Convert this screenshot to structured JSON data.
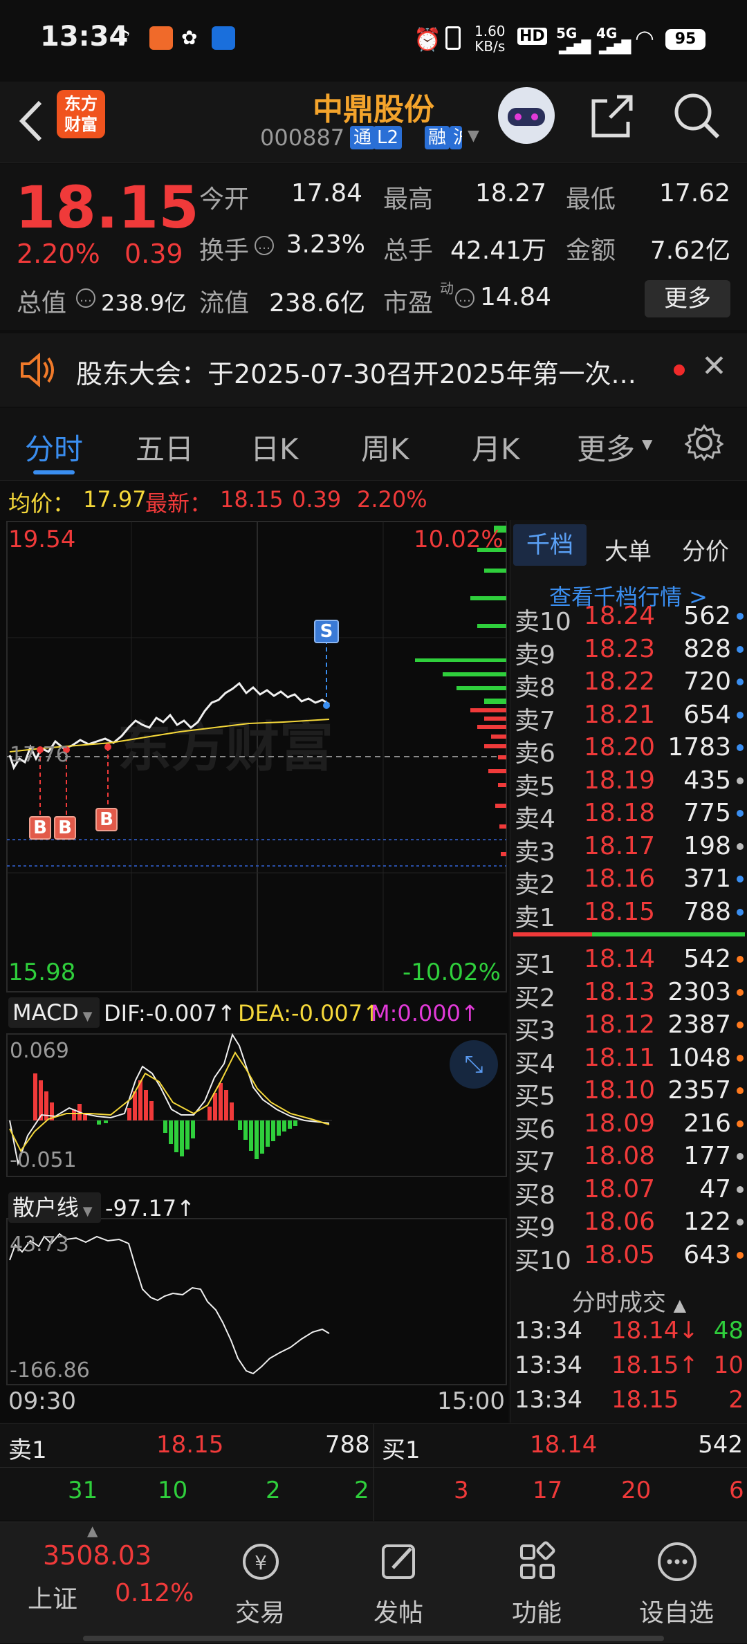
{
  "status_bar": {
    "time": "13:34",
    "net_speed_top": "1.60",
    "net_speed_unit": "KB/s",
    "signal_1": "5G",
    "signal_2": "4G",
    "battery": "95"
  },
  "header": {
    "logo_text_1": "东方",
    "logo_text_2": "财富",
    "stock_name": "中鼎股份",
    "stock_code": "000887",
    "tags": [
      "通",
      "L2",
      "融",
      "沪"
    ]
  },
  "quote": {
    "price": "18.15",
    "change_pct": "2.20%",
    "change": "0.39",
    "open_label": "今开",
    "open": "17.84",
    "high_label": "最高",
    "high": "18.27",
    "low_label": "最低",
    "low": "17.62",
    "turnover_label": "换手",
    "turnover": "3.23%",
    "volume_label": "总手",
    "volume": "42.41万",
    "amount_label": "金额",
    "amount": "7.62亿",
    "mktcap_label": "总值",
    "mktcap": "238.9亿",
    "float_label": "流值",
    "float": "238.6亿",
    "pe_label": "市盈",
    "pe_sup": "动",
    "pe": "14.84",
    "more_label": "更多"
  },
  "notice": {
    "text": "股东大会：于2025-07-30召开2025年第一次..."
  },
  "tabs": [
    "分时",
    "五日",
    "日K",
    "周K",
    "月K",
    "更多"
  ],
  "avg_bar": {
    "avg_label": "均价：",
    "avg": "17.97",
    "latest_label": "最新：",
    "latest": "18.15",
    "change": "0.39",
    "pct": "2.20%"
  },
  "chart": {
    "y_top": "19.54",
    "y_top_pct": "10.02%",
    "y_bottom": "15.98",
    "y_bottom_pct": "-10.02%",
    "prev_close": "17.76",
    "watermark": "东方财富",
    "time_start": "09:30",
    "time_end": "15:00",
    "markers": [
      "B",
      "B",
      "B",
      "S"
    ]
  },
  "macd": {
    "name": "MACD",
    "dif": "DIF:-0.007↑",
    "dea": "DEA:-0.007↑",
    "m": "M:0.000↑",
    "y_top": "0.069",
    "y_bottom": "-0.051"
  },
  "retail": {
    "name": "散户线",
    "value": "-97.17↑",
    "y_top": "43.73",
    "y_bottom": "-166.86"
  },
  "panel_tabs": [
    "千档",
    "大单",
    "分价"
  ],
  "panel_link": "查看千档行情 >",
  "sell_orders": [
    {
      "label": "卖10",
      "price": "18.24",
      "vol": "562"
    },
    {
      "label": "卖9",
      "price": "18.23",
      "vol": "828"
    },
    {
      "label": "卖8",
      "price": "18.22",
      "vol": "720"
    },
    {
      "label": "卖7",
      "price": "18.21",
      "vol": "654"
    },
    {
      "label": "卖6",
      "price": "18.20",
      "vol": "1783"
    },
    {
      "label": "卖5",
      "price": "18.19",
      "vol": "435"
    },
    {
      "label": "卖4",
      "price": "18.18",
      "vol": "775"
    },
    {
      "label": "卖3",
      "price": "18.17",
      "vol": "198"
    },
    {
      "label": "卖2",
      "price": "18.16",
      "vol": "371"
    },
    {
      "label": "卖1",
      "price": "18.15",
      "vol": "788"
    }
  ],
  "buy_orders": [
    {
      "label": "买1",
      "price": "18.14",
      "vol": "542"
    },
    {
      "label": "买2",
      "price": "18.13",
      "vol": "2303"
    },
    {
      "label": "买3",
      "price": "18.12",
      "vol": "2387"
    },
    {
      "label": "买4",
      "price": "18.11",
      "vol": "1048"
    },
    {
      "label": "买5",
      "price": "18.10",
      "vol": "2357"
    },
    {
      "label": "买6",
      "price": "18.09",
      "vol": "216"
    },
    {
      "label": "买7",
      "price": "18.08",
      "vol": "177"
    },
    {
      "label": "买8",
      "price": "18.07",
      "vol": "47"
    },
    {
      "label": "买9",
      "price": "18.06",
      "vol": "122"
    },
    {
      "label": "买10",
      "price": "18.05",
      "vol": "643"
    }
  ],
  "trades_title": "分时成交",
  "trades": [
    {
      "time": "13:34",
      "price": "18.14↓",
      "vol": "48"
    },
    {
      "time": "13:34",
      "price": "18.15↑",
      "vol": "10"
    },
    {
      "time": "13:34",
      "price": "18.15",
      "vol": "2"
    }
  ],
  "bottom_book": {
    "sell_label": "卖1",
    "sell_price": "18.15",
    "sell_vol": "788",
    "buy_label": "买1",
    "buy_price": "18.14",
    "buy_vol": "542",
    "sell_ticks": [
      "31",
      "10",
      "2",
      "2"
    ],
    "buy_ticks": [
      "3",
      "17",
      "20",
      "6"
    ]
  },
  "navbar": {
    "index_value": "3508.03",
    "index_name": "上证",
    "index_pct": "0.12%",
    "items": [
      "交易",
      "发帖",
      "功能",
      "设自选"
    ]
  },
  "colors": {
    "up": "#f03a3a",
    "down": "#2fcf3c",
    "accent": "#f4a42c",
    "blue": "#3a8ef0"
  }
}
